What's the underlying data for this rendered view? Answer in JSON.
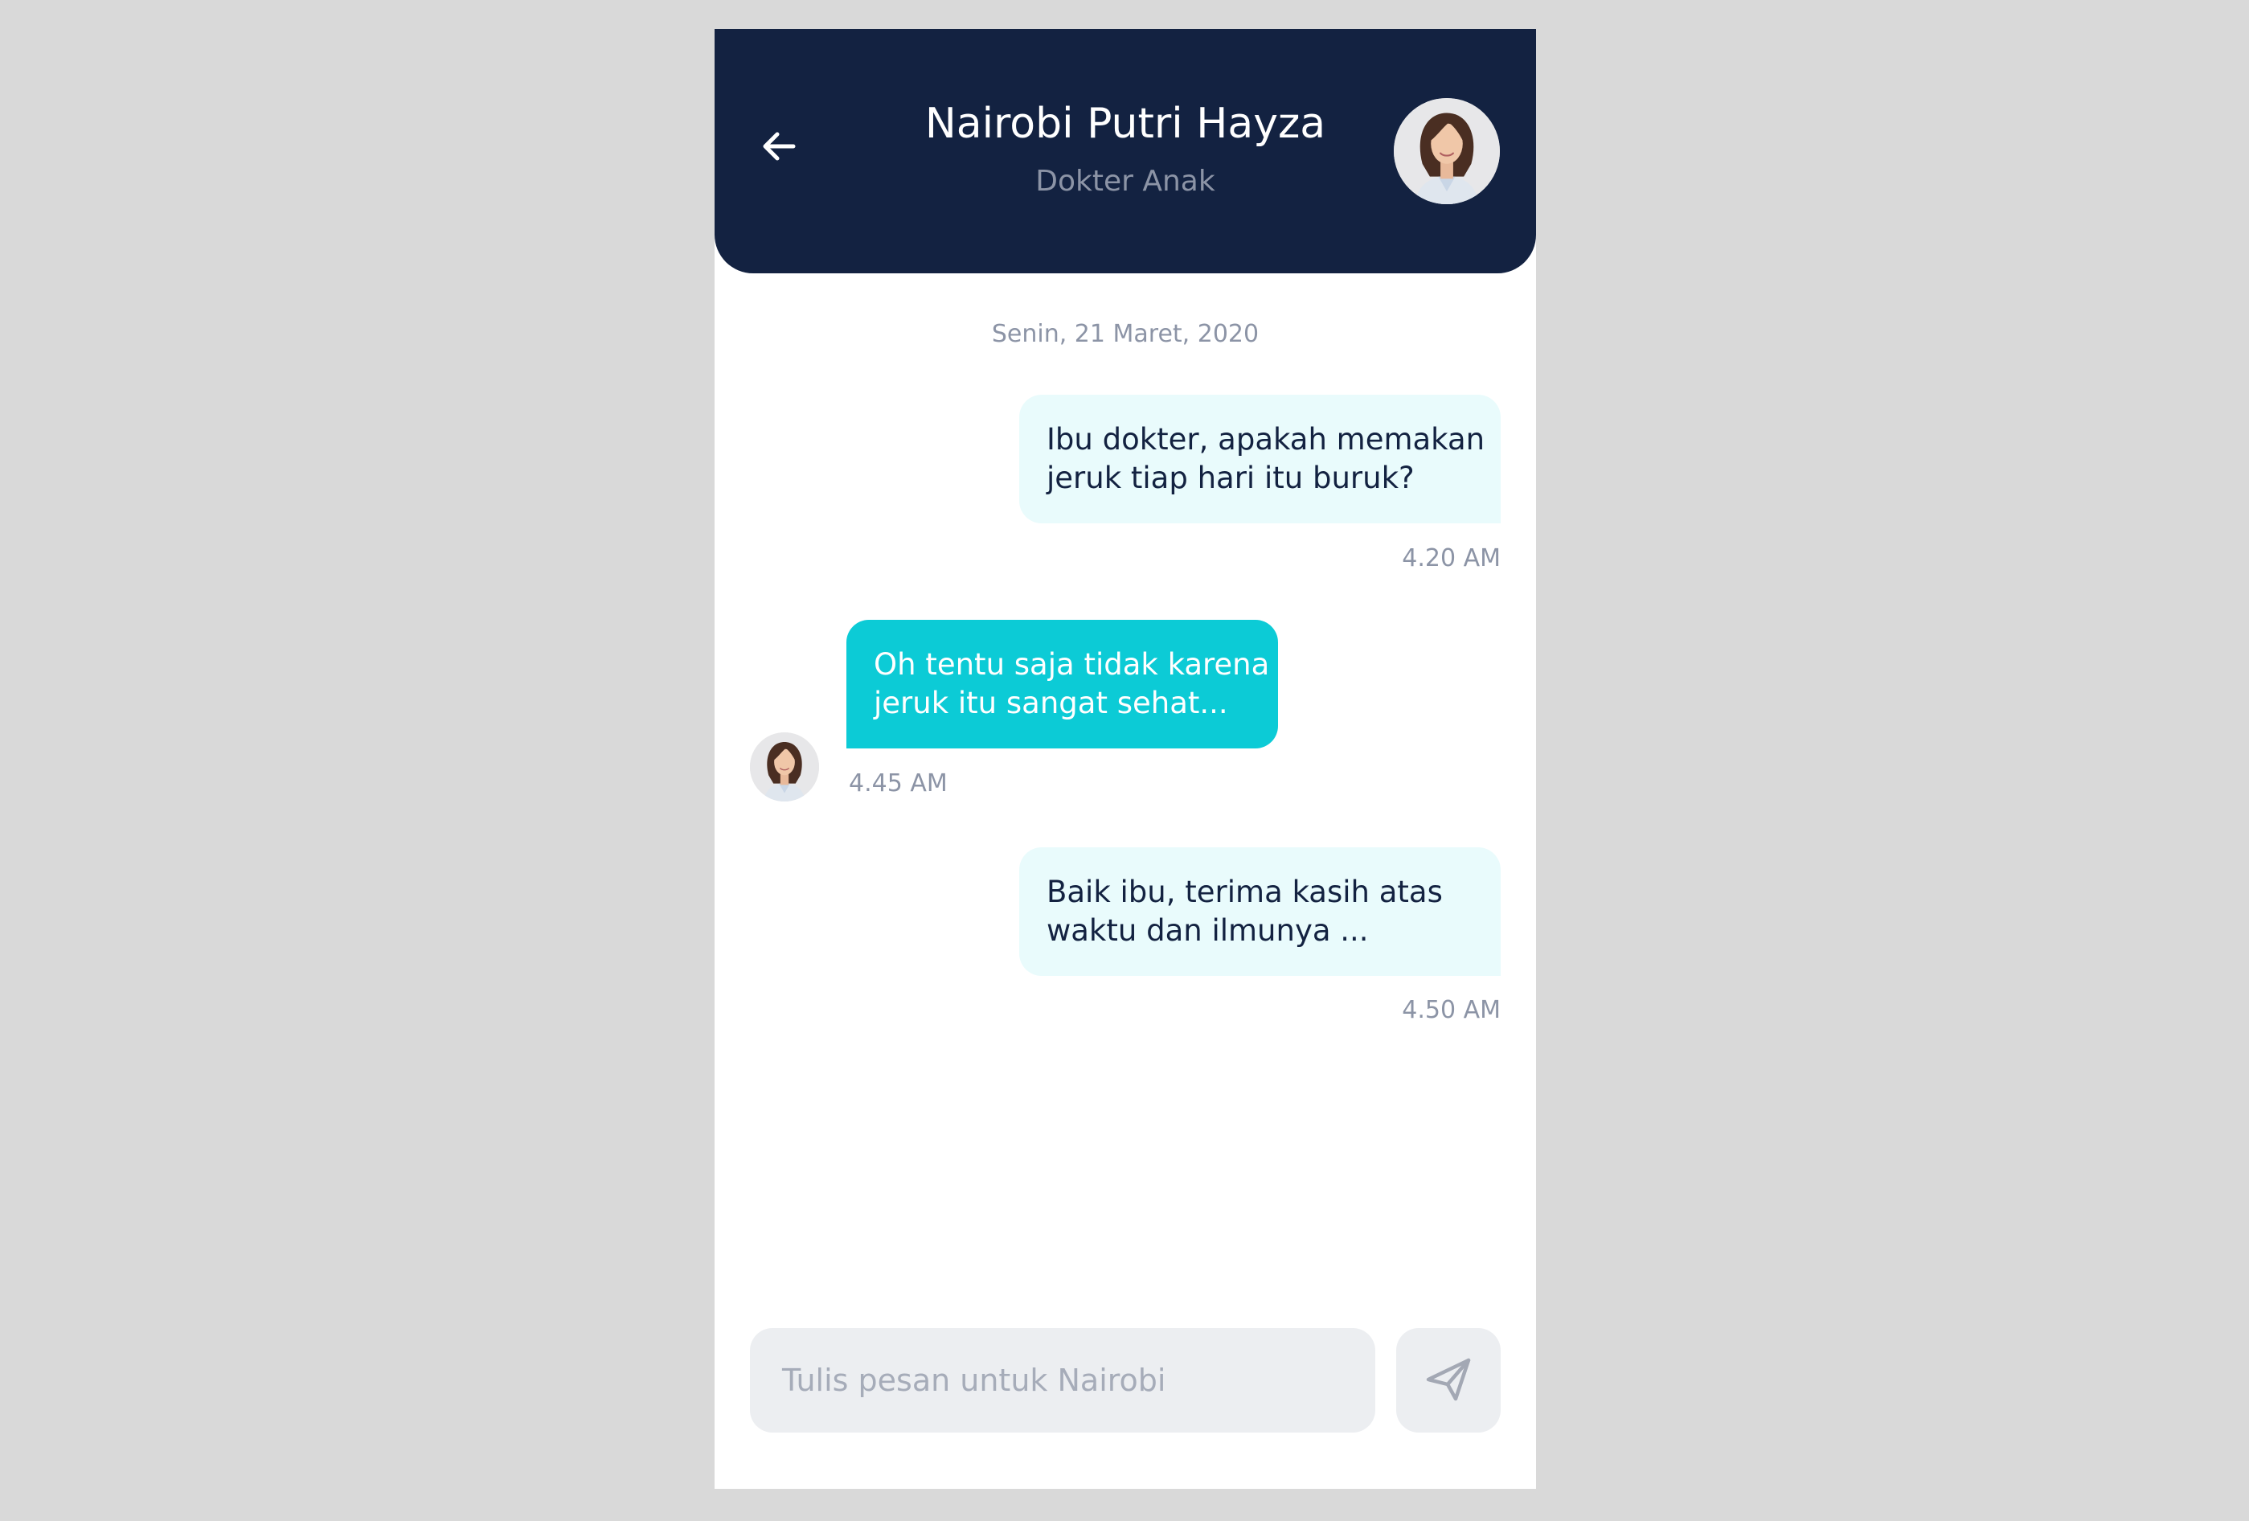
{
  "header": {
    "back_icon": "arrow-left-icon",
    "contact_name": "Nairobi Putri Hayza",
    "contact_role": "Dokter Anak"
  },
  "chat": {
    "date": "Senin, 21 Maret, 2020",
    "messages": [
      {
        "direction": "sent",
        "lines": [
          "Ibu dokter, apakah memakan",
          "jeruk tiap hari itu buruk?"
        ],
        "time": "4.20 AM"
      },
      {
        "direction": "received",
        "lines": [
          "Oh tentu saja tidak karena",
          "jeruk itu sangat sehat..."
        ],
        "time": "4.45 AM"
      },
      {
        "direction": "sent",
        "lines": [
          "Baik ibu, terima kasih atas",
          "waktu dan ilmunya ..."
        ],
        "time": "4.50 AM"
      }
    ]
  },
  "composer": {
    "placeholder": "Tulis pesan untuk Nairobi",
    "send_icon": "paper-plane-icon"
  },
  "colors": {
    "header_bg": "#132241",
    "sent_bubble": "#e9fbfc",
    "received_bubble": "#0ccbd6",
    "muted_text": "#8c94a6",
    "input_bg": "#eceef1"
  }
}
